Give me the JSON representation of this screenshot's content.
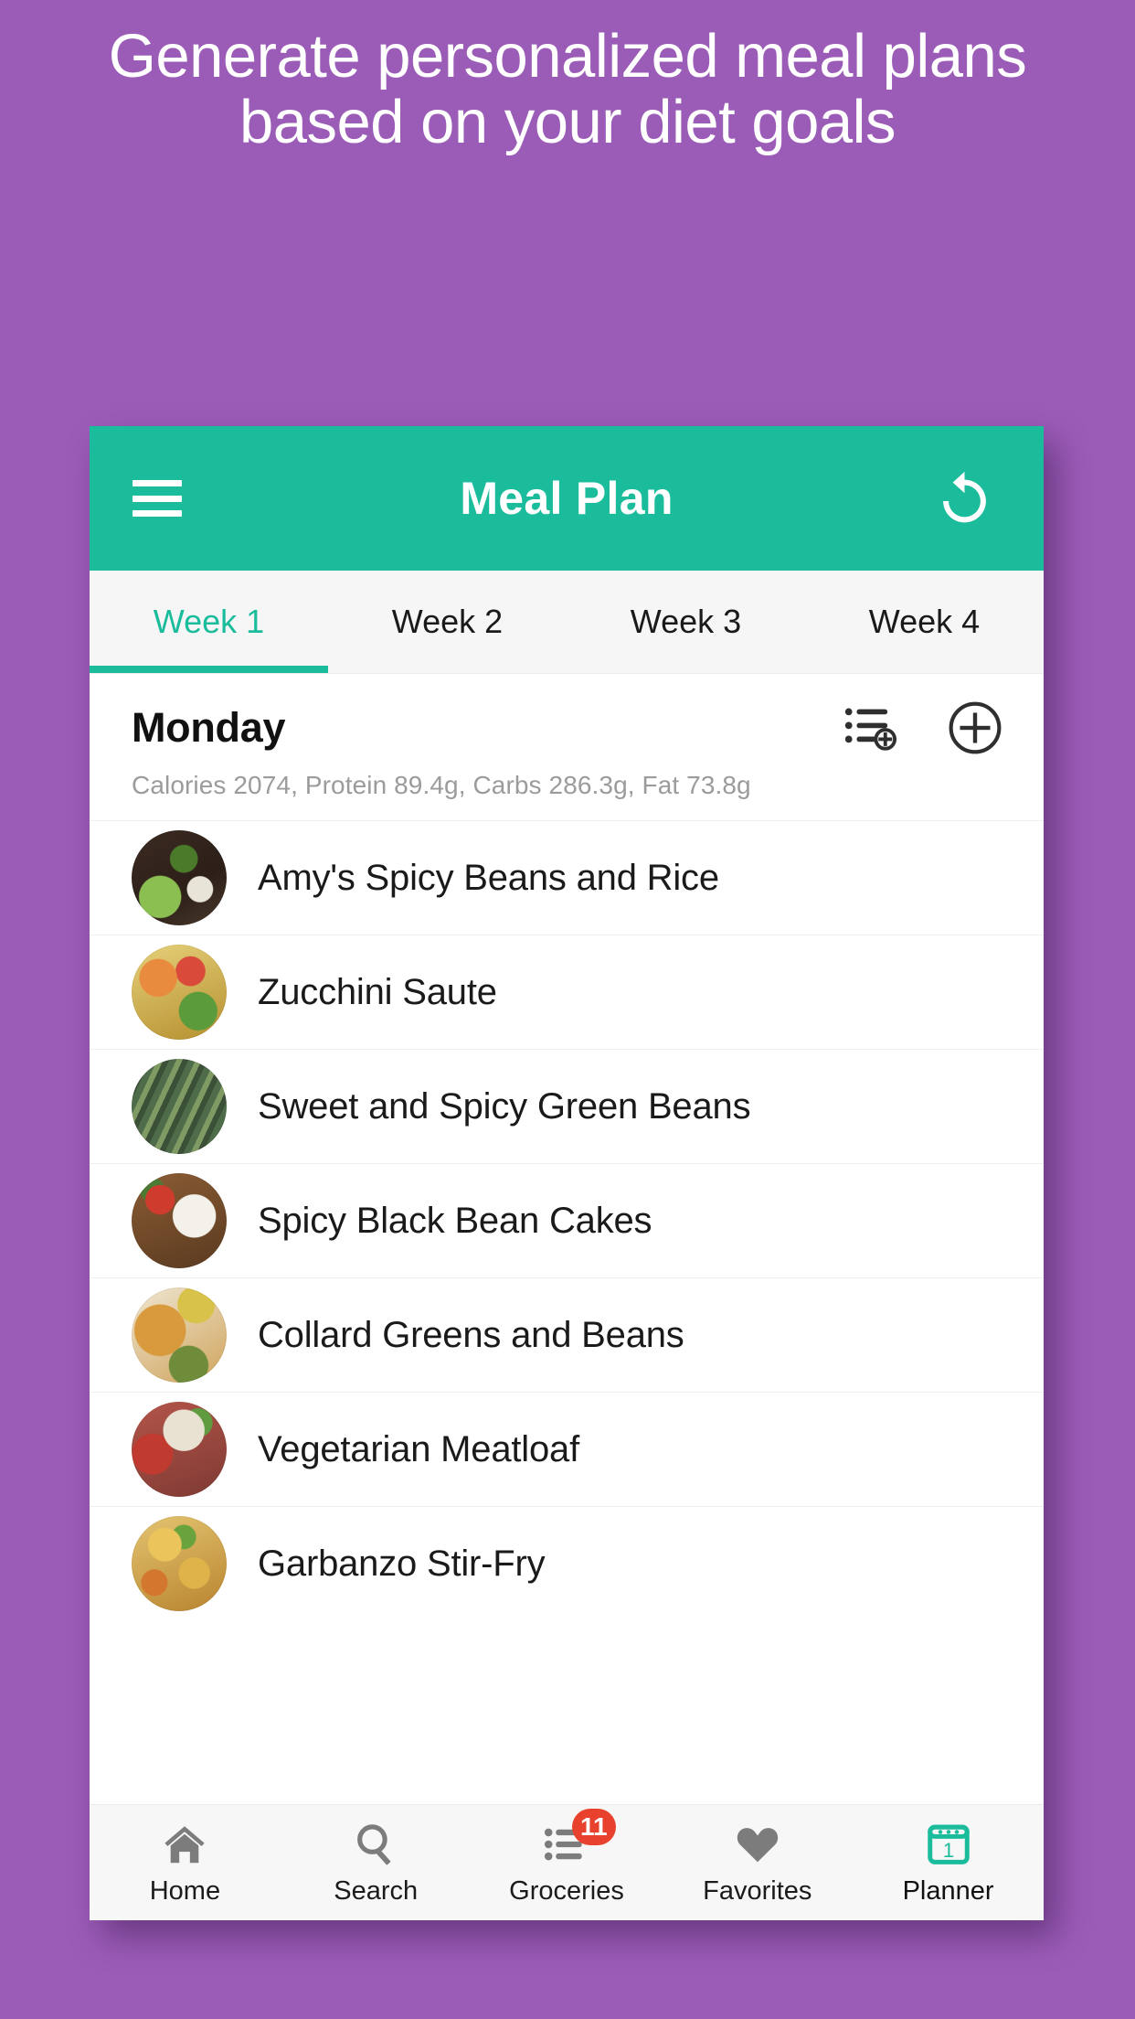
{
  "promo": {
    "line1": "Generate personalized meal plans",
    "line2": "based on your diet goals",
    "background_color": "#9b5cb8",
    "text_color": "#ffffff"
  },
  "app": {
    "accent_color": "#1abc9c",
    "appbar": {
      "title": "Meal Plan",
      "menu_icon": "hamburger-menu-icon",
      "action_icon": "restore-rotate-left-icon"
    },
    "tabs": [
      {
        "label": "Week 1",
        "active": true
      },
      {
        "label": "Week 2",
        "active": false
      },
      {
        "label": "Week 3",
        "active": false
      },
      {
        "label": "Week 4",
        "active": false
      }
    ],
    "day": {
      "name": "Monday",
      "nutrition": "Calories 2074, Protein 89.4g, Carbs 286.3g, Fat 73.8g",
      "actions": [
        {
          "icon": "playlist-add-icon",
          "name": "add-to-list-button"
        },
        {
          "icon": "plus-circle-icon",
          "name": "add-meal-button"
        }
      ]
    },
    "meals": [
      {
        "name": "Amy's Spicy Beans and Rice"
      },
      {
        "name": "Zucchini Saute"
      },
      {
        "name": "Sweet and Spicy Green Beans"
      },
      {
        "name": "Spicy Black Bean Cakes"
      },
      {
        "name": "Collard Greens and Beans"
      },
      {
        "name": "Vegetarian Meatloaf"
      },
      {
        "name": "Garbanzo Stir-Fry"
      }
    ],
    "bottom_nav": [
      {
        "label": "Home",
        "icon": "home-icon",
        "active": false,
        "badge": null
      },
      {
        "label": "Search",
        "icon": "search-icon",
        "active": false,
        "badge": null
      },
      {
        "label": "Groceries",
        "icon": "list-icon",
        "active": false,
        "badge": "11"
      },
      {
        "label": "Favorites",
        "icon": "heart-icon",
        "active": false,
        "badge": null
      },
      {
        "label": "Planner",
        "icon": "calendar-icon",
        "active": true,
        "badge": null
      }
    ],
    "badge_color": "#e8412d"
  }
}
